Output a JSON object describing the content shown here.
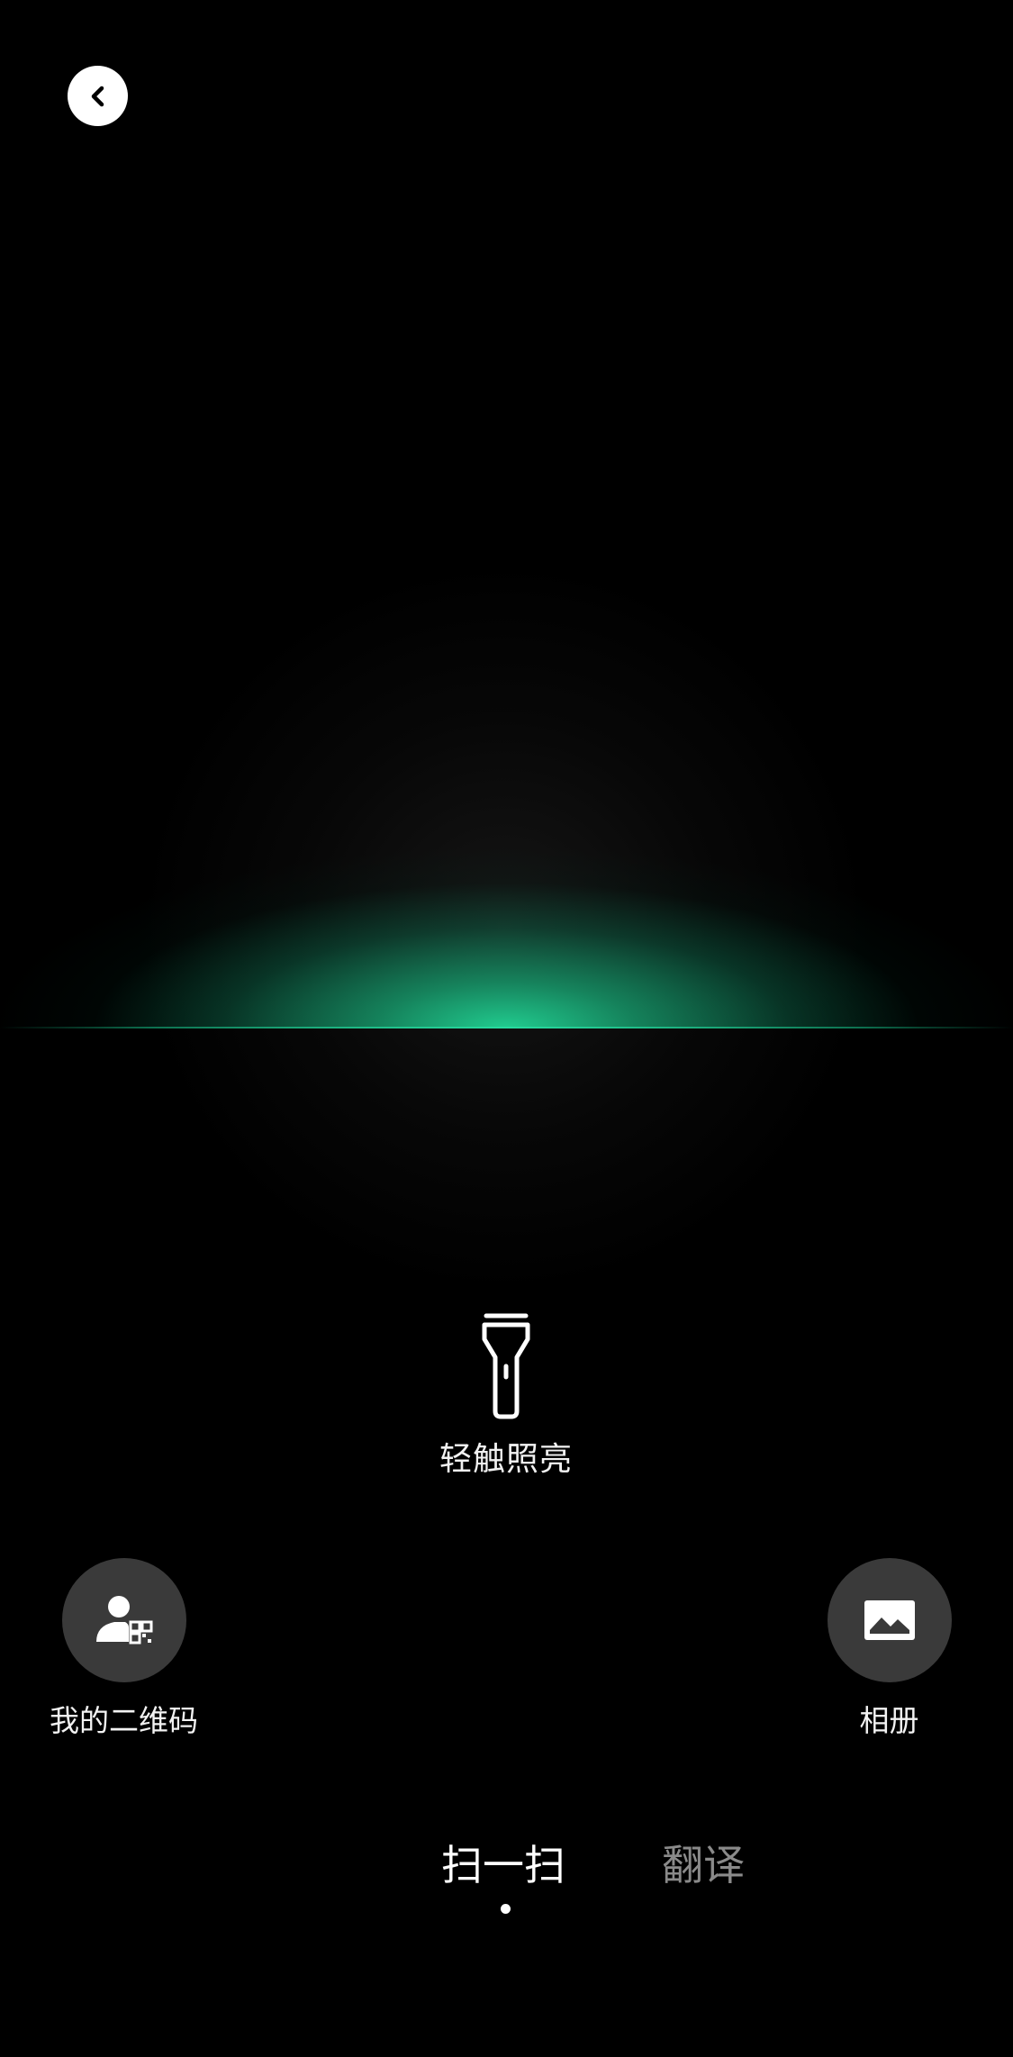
{
  "colors": {
    "background": "#000000",
    "scan_accent": "#22d696",
    "action_circle": "#3a3a3a",
    "tab_active": "#ffffff",
    "tab_inactive": "#8a8a8a"
  },
  "header": {
    "back_icon": "chevron-left-icon"
  },
  "torch": {
    "icon": "flashlight-icon",
    "label": "轻触照亮"
  },
  "actions": {
    "my_qr": {
      "icon": "user-qrcode-icon",
      "label": "我的二维码"
    },
    "album": {
      "icon": "image-icon",
      "label": "相册"
    }
  },
  "tabs": [
    {
      "label": "扫一扫",
      "active": true
    },
    {
      "label": "翻译",
      "active": false
    }
  ]
}
